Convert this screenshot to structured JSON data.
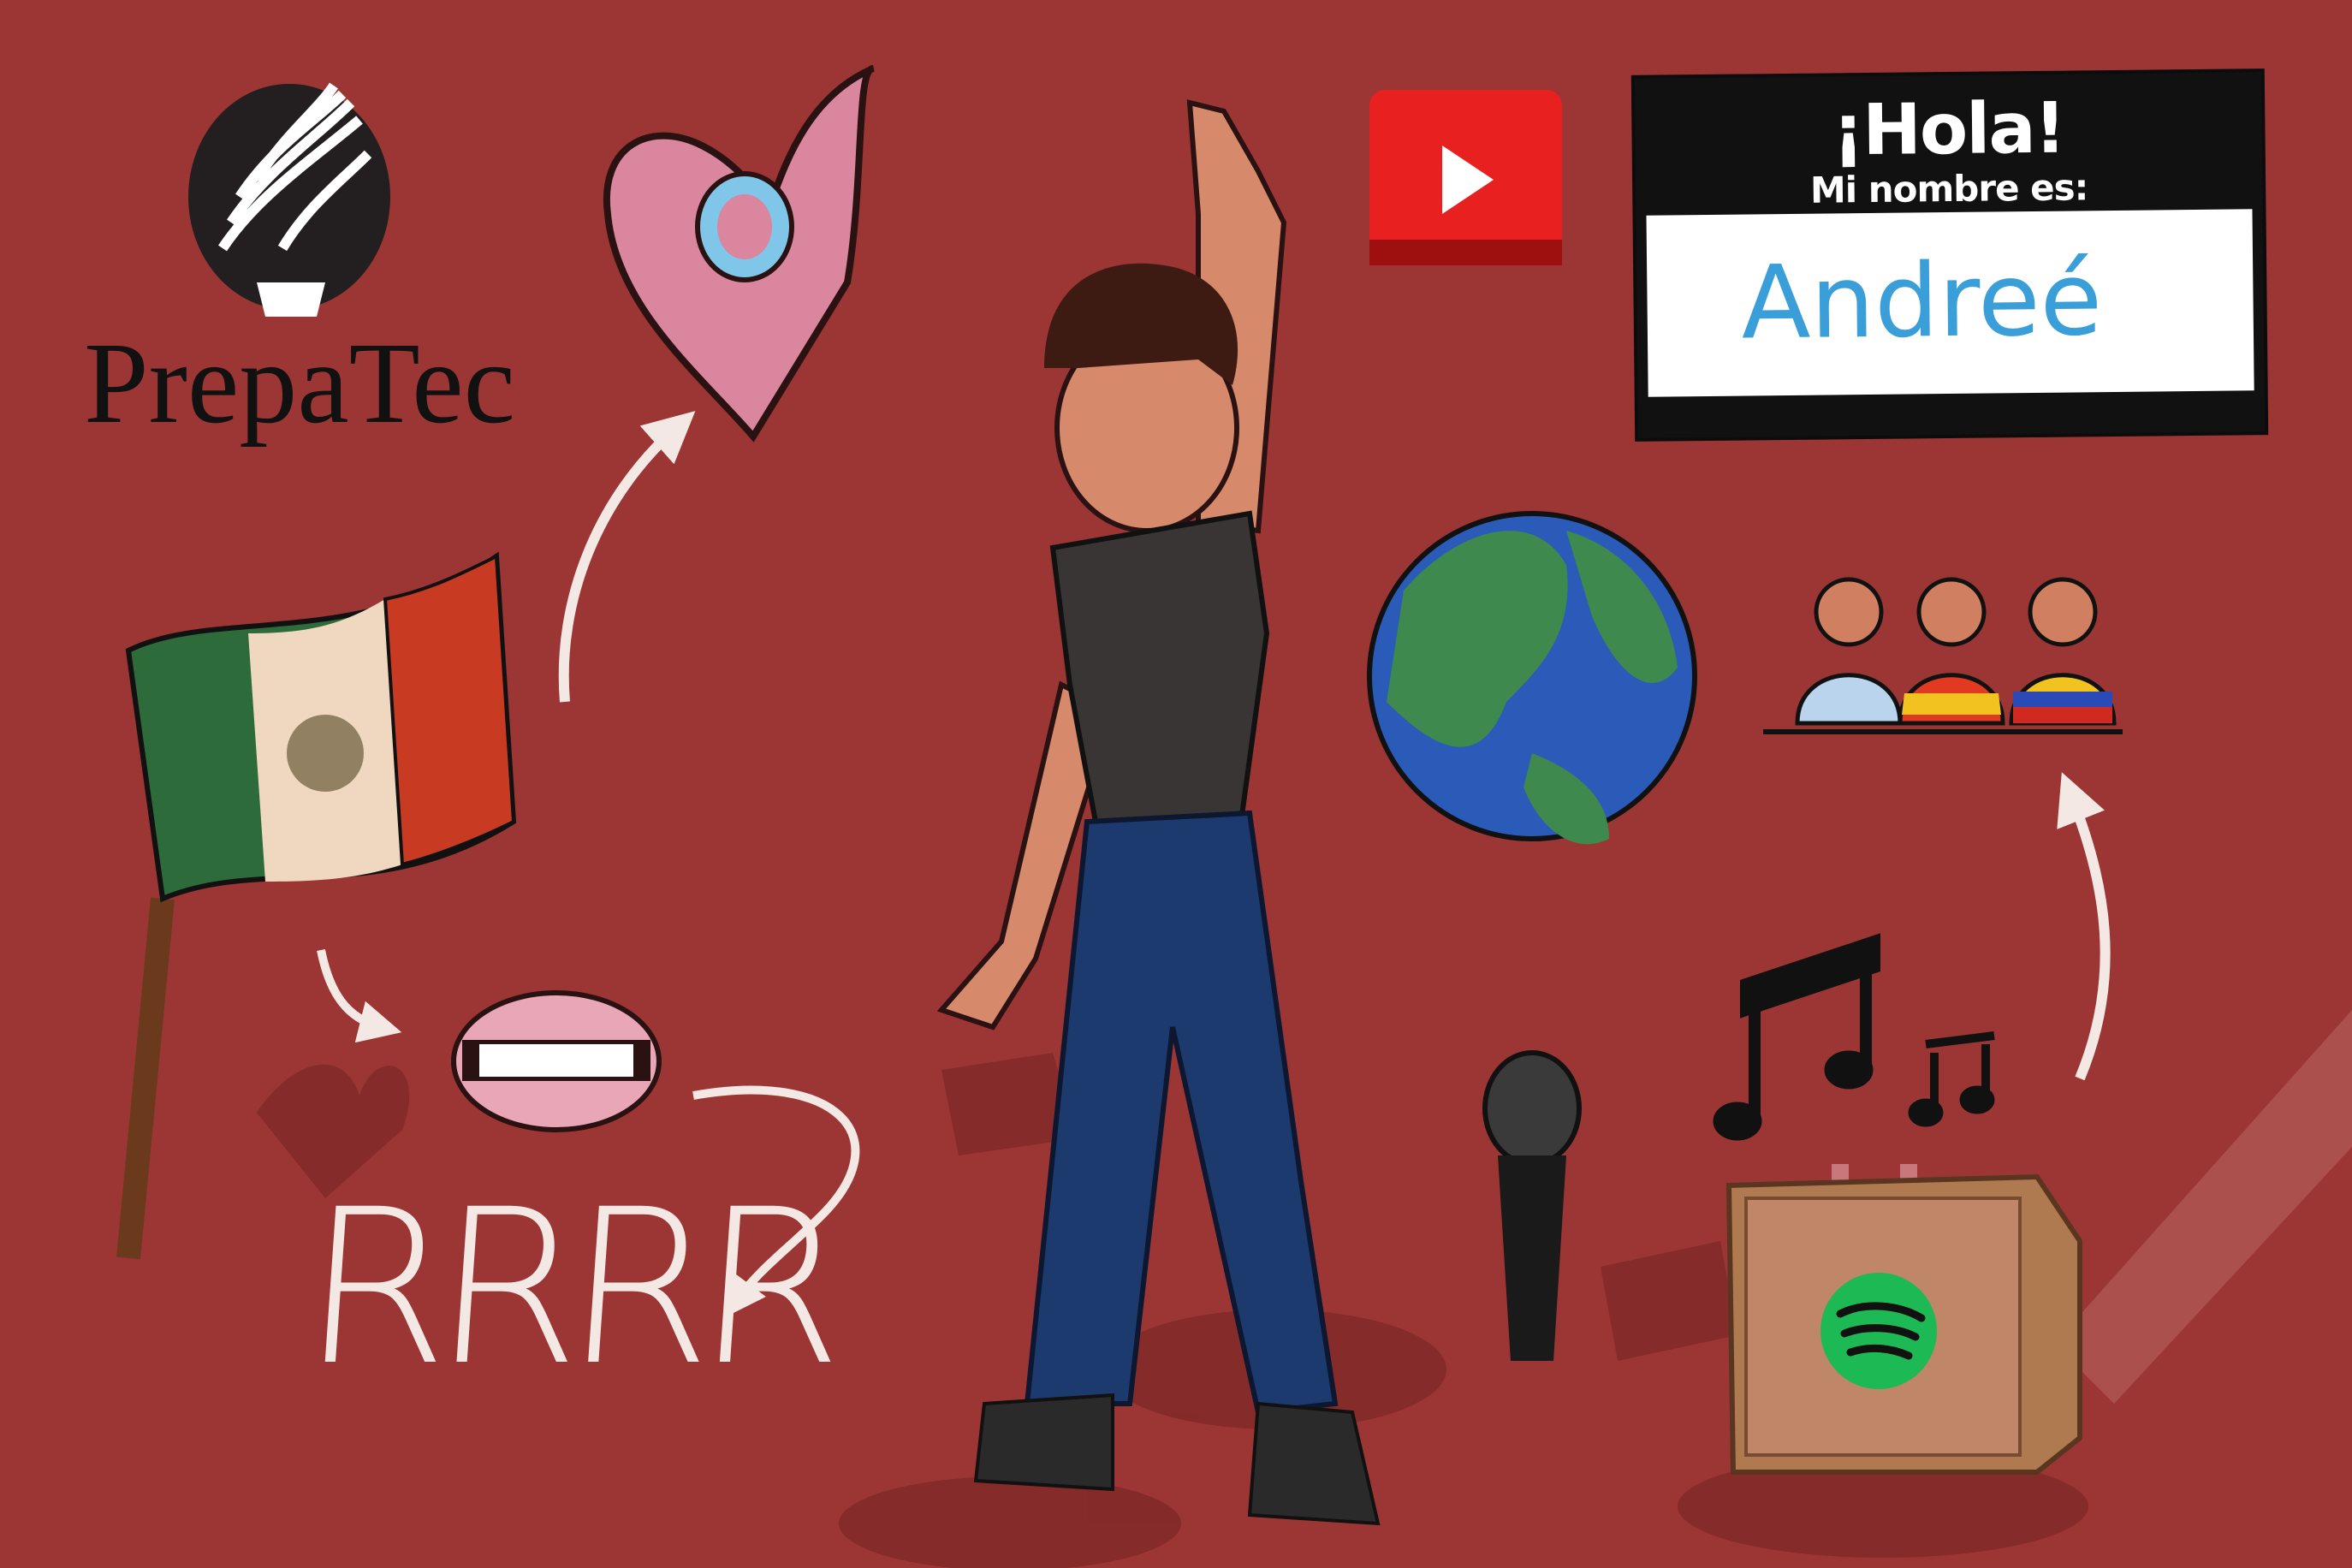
{
  "logo": {
    "text": "PrepaTec"
  },
  "name_tag": {
    "greeting": "¡Hola!",
    "subtitle": "Mi nombre es:",
    "name": "Andreé"
  },
  "doodle": {
    "letters": "RRRR"
  },
  "icons": [
    "prepatec-torch-icon",
    "heart-icon",
    "mexico-flag-icon",
    "mouth-icon",
    "youtube-icon",
    "globe-icon",
    "people-flags-icon",
    "music-notes-icon",
    "microphone-icon",
    "spotify-speaker-icon"
  ],
  "colors": {
    "background": "#9b3634",
    "youtube_red": "#e8201f",
    "spotify_green": "#1db954",
    "name_blue": "#3a9fd8",
    "heart_pink": "#d9869e"
  }
}
